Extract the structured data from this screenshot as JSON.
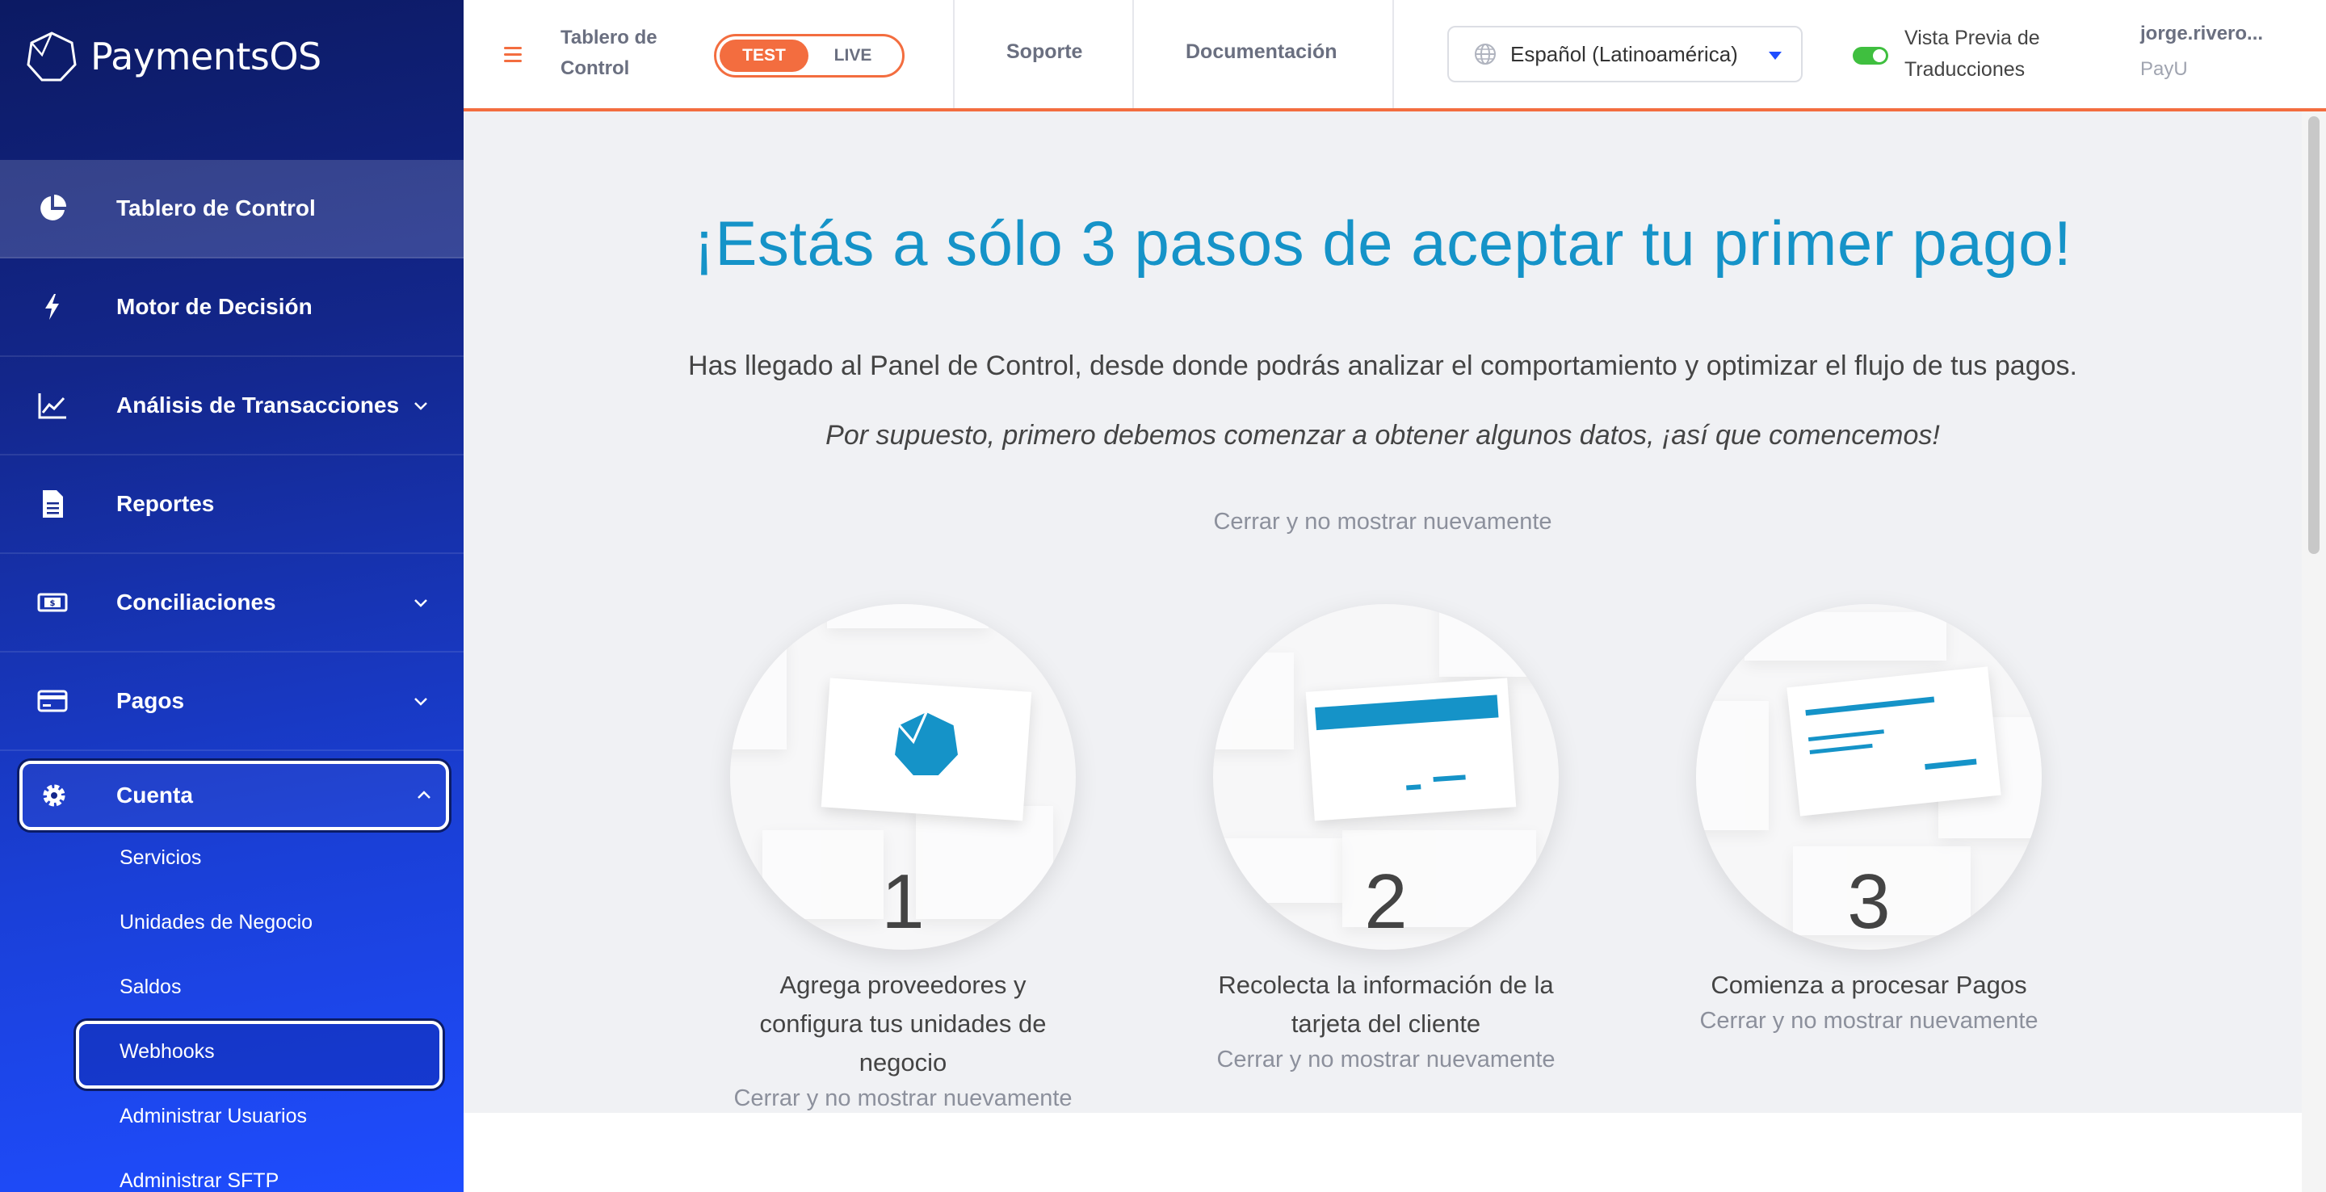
{
  "app": {
    "name": "PaymentsOS"
  },
  "sidebar": {
    "items": [
      {
        "label": "Tablero de Control",
        "icon": "pie-chart-icon",
        "active": true
      },
      {
        "label": "Motor de Decisión",
        "icon": "lightning-icon"
      },
      {
        "label": "Análisis de Transacciones",
        "icon": "trend-chart-icon",
        "expandable": true
      },
      {
        "label": "Reportes",
        "icon": "document-icon"
      },
      {
        "label": "Conciliaciones",
        "icon": "money-icon",
        "expandable": true
      },
      {
        "label": "Pagos",
        "icon": "credit-card-icon",
        "expandable": true
      },
      {
        "label": "Cuenta",
        "icon": "gear-icon",
        "expanded": true
      }
    ],
    "subitems": [
      "Servicios",
      "Unidades de Negocio",
      "Saldos",
      "Webhooks",
      "Administrar Usuarios",
      "Administrar SFTP"
    ]
  },
  "topbar": {
    "title": "Tablero de Control",
    "env_test": "TEST",
    "env_live": "LIVE",
    "support": "Soporte",
    "docs": "Documentación",
    "language": "Español (Latinoamérica)",
    "preview_label": "Vista Previa de Traducciones",
    "user": "jorge.rivero...",
    "org": "PayU"
  },
  "main": {
    "headline": "¡Estás a sólo 3 pasos de aceptar tu primer pago!",
    "lead": "Has llegado al Panel de Control, desde donde podrás analizar el comportamiento y optimizar el flujo de tus pagos.",
    "lead2": "Por supuesto, primero debemos comenzar a obtener algunos datos, ¡así que comencemos!",
    "dismiss": "Cerrar y no mostrar nuevamente",
    "steps": [
      {
        "num": "1",
        "title": "Agrega proveedores y configura tus unidades de negocio",
        "dismiss": "Cerrar y no mostrar nuevamente"
      },
      {
        "num": "2",
        "title": "Recolecta la información de la tarjeta del cliente",
        "dismiss": "Cerrar y no mostrar nuevamente"
      },
      {
        "num": "3",
        "title": "Comienza a procesar Pagos",
        "dismiss": "Cerrar y no mostrar nuevamente"
      }
    ]
  },
  "colors": {
    "accent": "#f36d3f",
    "brand": "#1593c8",
    "sidebar": "#13268a",
    "toggle_on": "#3fbf3f"
  }
}
